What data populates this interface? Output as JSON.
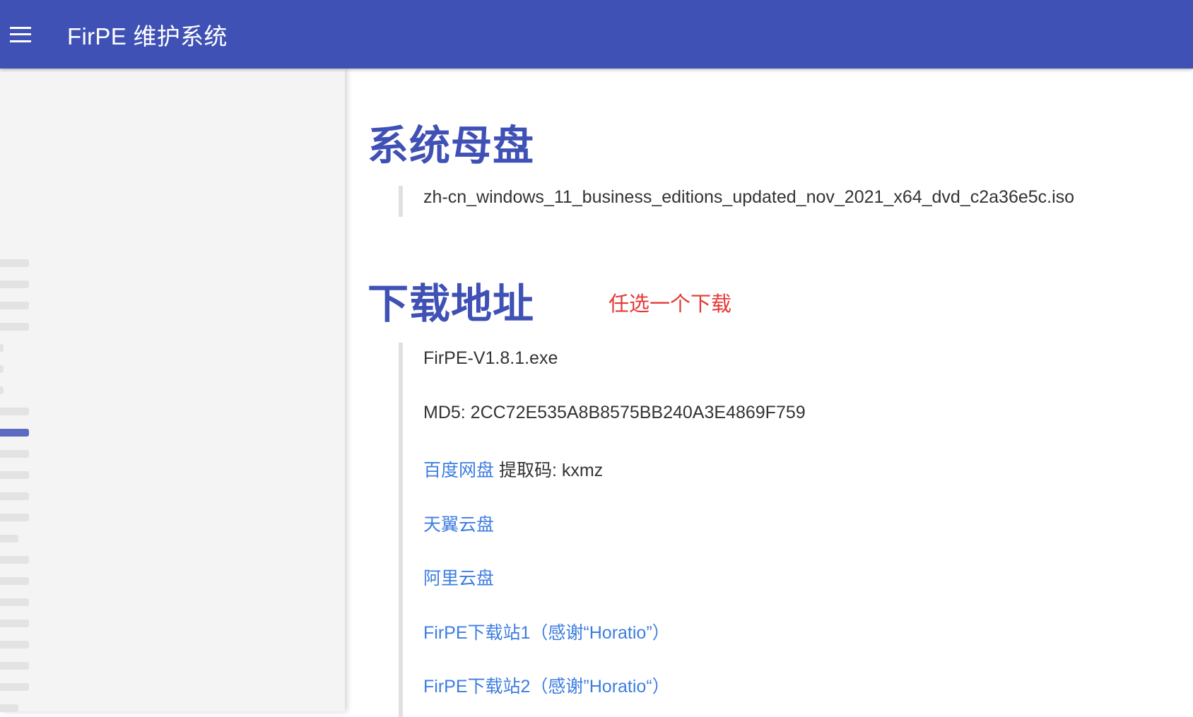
{
  "app_bar": {
    "title": "FirPE 维护系统"
  },
  "sidebar": {
    "collapsed_items": [
      "",
      "",
      "",
      "",
      "",
      "",
      "",
      "",
      "",
      "",
      "",
      "",
      "",
      "",
      "",
      "",
      "",
      "",
      "",
      "",
      "",
      "",
      ""
    ]
  },
  "content": {
    "section1": {
      "heading": "系统母盘",
      "iso_name": "zh-cn_windows_11_business_editions_updated_nov_2021_x64_dvd_c2a36e5c.iso"
    },
    "section2": {
      "heading": "下载地址",
      "note": "任选一个下载",
      "file_name": "FirPE-V1.8.1.exe",
      "md5_line": "MD5: 2CC72E535A8B8575BB240A3E4869F759",
      "baidu_link": "百度网盘",
      "baidu_code": " 提取码: kxmz",
      "tianyi_link": "天翼云盘",
      "aliyun_link": "阿里云盘",
      "mirror1_link": "FirPE下载站1（感谢“Horatio”）",
      "mirror2_link": "FirPE下载站2（感谢”Horatio“）"
    }
  },
  "colors": {
    "primary": "#3f51b5",
    "link": "#3d7de0",
    "note": "#e53935"
  }
}
